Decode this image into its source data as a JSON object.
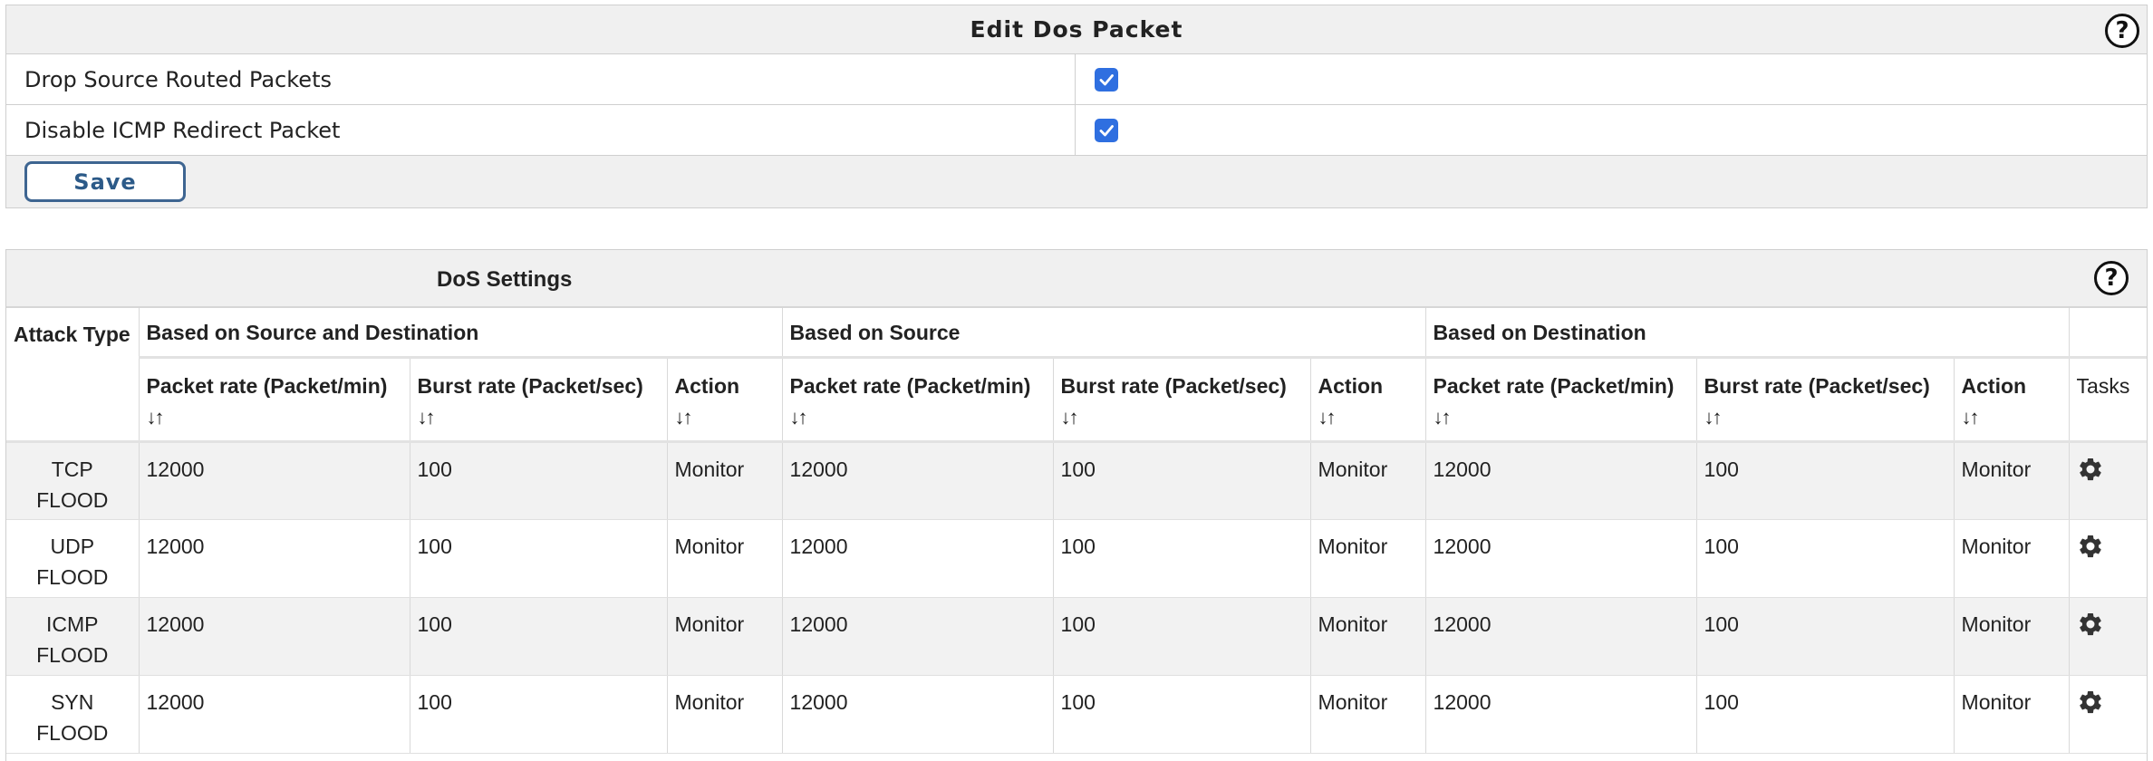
{
  "edit_panel": {
    "title": "Edit Dos Packet",
    "help_icon": "question-circle-icon",
    "options": [
      {
        "label": "Drop Source Routed Packets",
        "checked": true
      },
      {
        "label": "Disable ICMP Redirect Packet",
        "checked": true
      }
    ],
    "save_label": "Save"
  },
  "dos_panel": {
    "title": "DoS Settings",
    "help_icon": "question-circle-icon",
    "table": {
      "attack_header": "Attack Type",
      "groups": [
        "Based on Source and Destination",
        "Based on Source",
        "Based on Destination"
      ],
      "columns": {
        "packet_rate": "Packet rate (Packet/min)",
        "burst_rate": "Burst rate (Packet/sec)",
        "action": "Action",
        "sort_icon": "↓↑"
      },
      "tasks_header": "Tasks",
      "task_icon": "gear-icon",
      "rows": [
        {
          "attack": "TCP FLOOD",
          "sd_packet": "12000",
          "sd_burst": "100",
          "sd_action": "Monitor",
          "s_packet": "12000",
          "s_burst": "100",
          "s_action": "Monitor",
          "d_packet": "12000",
          "d_burst": "100",
          "d_action": "Monitor"
        },
        {
          "attack": "UDP FLOOD",
          "sd_packet": "12000",
          "sd_burst": "100",
          "sd_action": "Monitor",
          "s_packet": "12000",
          "s_burst": "100",
          "s_action": "Monitor",
          "d_packet": "12000",
          "d_burst": "100",
          "d_action": "Monitor"
        },
        {
          "attack": "ICMP FLOOD",
          "sd_packet": "12000",
          "sd_burst": "100",
          "sd_action": "Monitor",
          "s_packet": "12000",
          "s_burst": "100",
          "s_action": "Monitor",
          "d_packet": "12000",
          "d_burst": "100",
          "d_action": "Monitor"
        },
        {
          "attack": "SYN FLOOD",
          "sd_packet": "12000",
          "sd_burst": "100",
          "sd_action": "Monitor",
          "s_packet": "12000",
          "s_burst": "100",
          "s_action": "Monitor",
          "d_packet": "12000",
          "d_burst": "100",
          "d_action": "Monitor"
        }
      ]
    }
  },
  "colors": {
    "checkbox": "#2f6fe0",
    "save_border": "#3e6591",
    "header_bg": "#f0f0f0",
    "row_alt": "#f2f2f2"
  }
}
